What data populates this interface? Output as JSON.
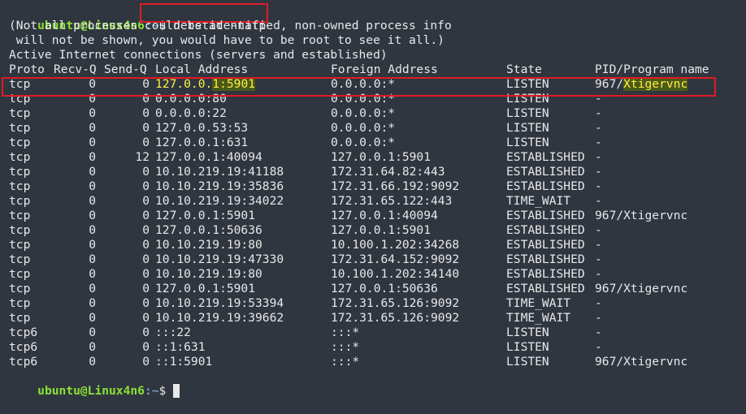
{
  "prompt": {
    "user_host": "ubuntu@Linux4n6",
    "path": ":~",
    "symbol": "$",
    "command": "netstat -natp"
  },
  "messages": [
    "(Not all processes could be identified, non-owned process info",
    " will not be shown, you would have to be root to see it all.)",
    "Active Internet connections (servers and established)"
  ],
  "headers": {
    "proto": "Proto",
    "recvq": "Recv-Q",
    "sendq": "Send-Q",
    "local": "Local Address",
    "foreign": "Foreign Address",
    "state": "State",
    "pid": "PID/Program name"
  },
  "rows": [
    {
      "proto": "tcp",
      "recvq": "0",
      "sendq": "0",
      "local": "127.0.0.1:5901",
      "foreign": "0.0.0.0:*",
      "state": "LISTEN",
      "pid": "967/Xtigervnc"
    },
    {
      "proto": "tcp",
      "recvq": "0",
      "sendq": "0",
      "local": "0.0.0.0:80",
      "foreign": "0.0.0.0:*",
      "state": "LISTEN",
      "pid": "-"
    },
    {
      "proto": "tcp",
      "recvq": "0",
      "sendq": "0",
      "local": "0.0.0.0:22",
      "foreign": "0.0.0.0:*",
      "state": "LISTEN",
      "pid": "-"
    },
    {
      "proto": "tcp",
      "recvq": "0",
      "sendq": "0",
      "local": "127.0.0.53:53",
      "foreign": "0.0.0.0:*",
      "state": "LISTEN",
      "pid": "-"
    },
    {
      "proto": "tcp",
      "recvq": "0",
      "sendq": "0",
      "local": "127.0.0.1:631",
      "foreign": "0.0.0.0:*",
      "state": "LISTEN",
      "pid": "-"
    },
    {
      "proto": "tcp",
      "recvq": "0",
      "sendq": "12",
      "local": "127.0.0.1:40094",
      "foreign": "127.0.0.1:5901",
      "state": "ESTABLISHED",
      "pid": "-"
    },
    {
      "proto": "tcp",
      "recvq": "0",
      "sendq": "0",
      "local": "10.10.219.19:41188",
      "foreign": "172.31.64.82:443",
      "state": "ESTABLISHED",
      "pid": "-"
    },
    {
      "proto": "tcp",
      "recvq": "0",
      "sendq": "0",
      "local": "10.10.219.19:35836",
      "foreign": "172.31.66.192:9092",
      "state": "ESTABLISHED",
      "pid": "-"
    },
    {
      "proto": "tcp",
      "recvq": "0",
      "sendq": "0",
      "local": "10.10.219.19:34022",
      "foreign": "172.31.65.122:443",
      "state": "TIME_WAIT",
      "pid": "-"
    },
    {
      "proto": "tcp",
      "recvq": "0",
      "sendq": "0",
      "local": "127.0.0.1:5901",
      "foreign": "127.0.0.1:40094",
      "state": "ESTABLISHED",
      "pid": "967/Xtigervnc"
    },
    {
      "proto": "tcp",
      "recvq": "0",
      "sendq": "0",
      "local": "127.0.0.1:50636",
      "foreign": "127.0.0.1:5901",
      "state": "ESTABLISHED",
      "pid": "-"
    },
    {
      "proto": "tcp",
      "recvq": "0",
      "sendq": "0",
      "local": "10.10.219.19:80",
      "foreign": "10.100.1.202:34268",
      "state": "ESTABLISHED",
      "pid": "-"
    },
    {
      "proto": "tcp",
      "recvq": "0",
      "sendq": "0",
      "local": "10.10.219.19:47330",
      "foreign": "172.31.64.152:9092",
      "state": "ESTABLISHED",
      "pid": "-"
    },
    {
      "proto": "tcp",
      "recvq": "0",
      "sendq": "0",
      "local": "10.10.219.19:80",
      "foreign": "10.100.1.202:34140",
      "state": "ESTABLISHED",
      "pid": "-"
    },
    {
      "proto": "tcp",
      "recvq": "0",
      "sendq": "0",
      "local": "127.0.0.1:5901",
      "foreign": "127.0.0.1:50636",
      "state": "ESTABLISHED",
      "pid": "967/Xtigervnc"
    },
    {
      "proto": "tcp",
      "recvq": "0",
      "sendq": "0",
      "local": "10.10.219.19:53394",
      "foreign": "172.31.65.126:9092",
      "state": "TIME_WAIT",
      "pid": "-"
    },
    {
      "proto": "tcp",
      "recvq": "0",
      "sendq": "0",
      "local": "10.10.219.19:39662",
      "foreign": "172.31.65.126:9092",
      "state": "TIME_WAIT",
      "pid": "-"
    },
    {
      "proto": "tcp6",
      "recvq": "0",
      "sendq": "0",
      "local": ":::22",
      "foreign": ":::*",
      "state": "LISTEN",
      "pid": "-"
    },
    {
      "proto": "tcp6",
      "recvq": "0",
      "sendq": "0",
      "local": "::1:631",
      "foreign": ":::*",
      "state": "LISTEN",
      "pid": "-"
    },
    {
      "proto": "tcp6",
      "recvq": "0",
      "sendq": "0",
      "local": "::1:5901",
      "foreign": ":::*",
      "state": "LISTEN",
      "pid": "967/Xtigervnc"
    }
  ],
  "highlighted_row": {
    "local_pre": "127.0.0.",
    "local_hl": "1:5901",
    "pid_pre": "967/",
    "pid_hl": "Xtigervnc"
  },
  "colors": {
    "background": "#2f3640",
    "prompt_user": "#8ae234",
    "prompt_path": "#729fcf",
    "annotation": "#e01b24",
    "highlight": "#ffee44"
  }
}
